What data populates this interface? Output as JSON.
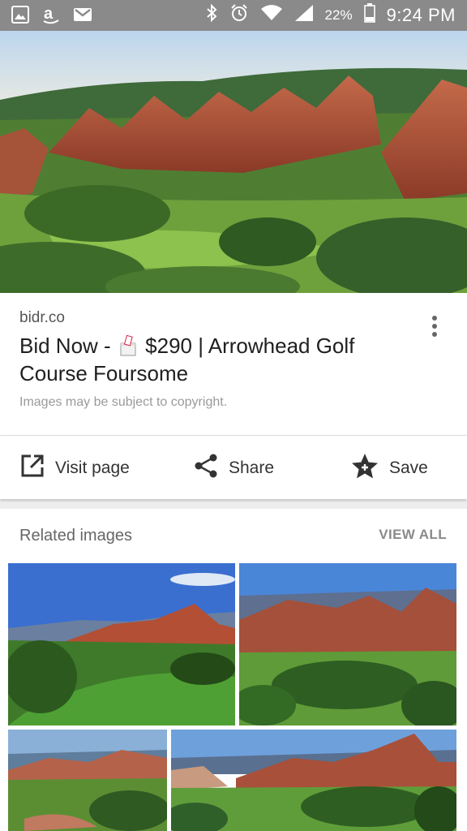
{
  "status_bar": {
    "battery": "22%",
    "time": "9:24 PM"
  },
  "result": {
    "domain": "bidr.co",
    "title_before": "Bid Now - ",
    "title_after": " $290 | Arrowhead Golf Course Foursome",
    "copyright_note": "Images may be subject to copyright."
  },
  "actions": {
    "visit": "Visit page",
    "share": "Share",
    "save": "Save"
  },
  "related": {
    "title": "Related images",
    "view_all": "VIEW ALL"
  }
}
